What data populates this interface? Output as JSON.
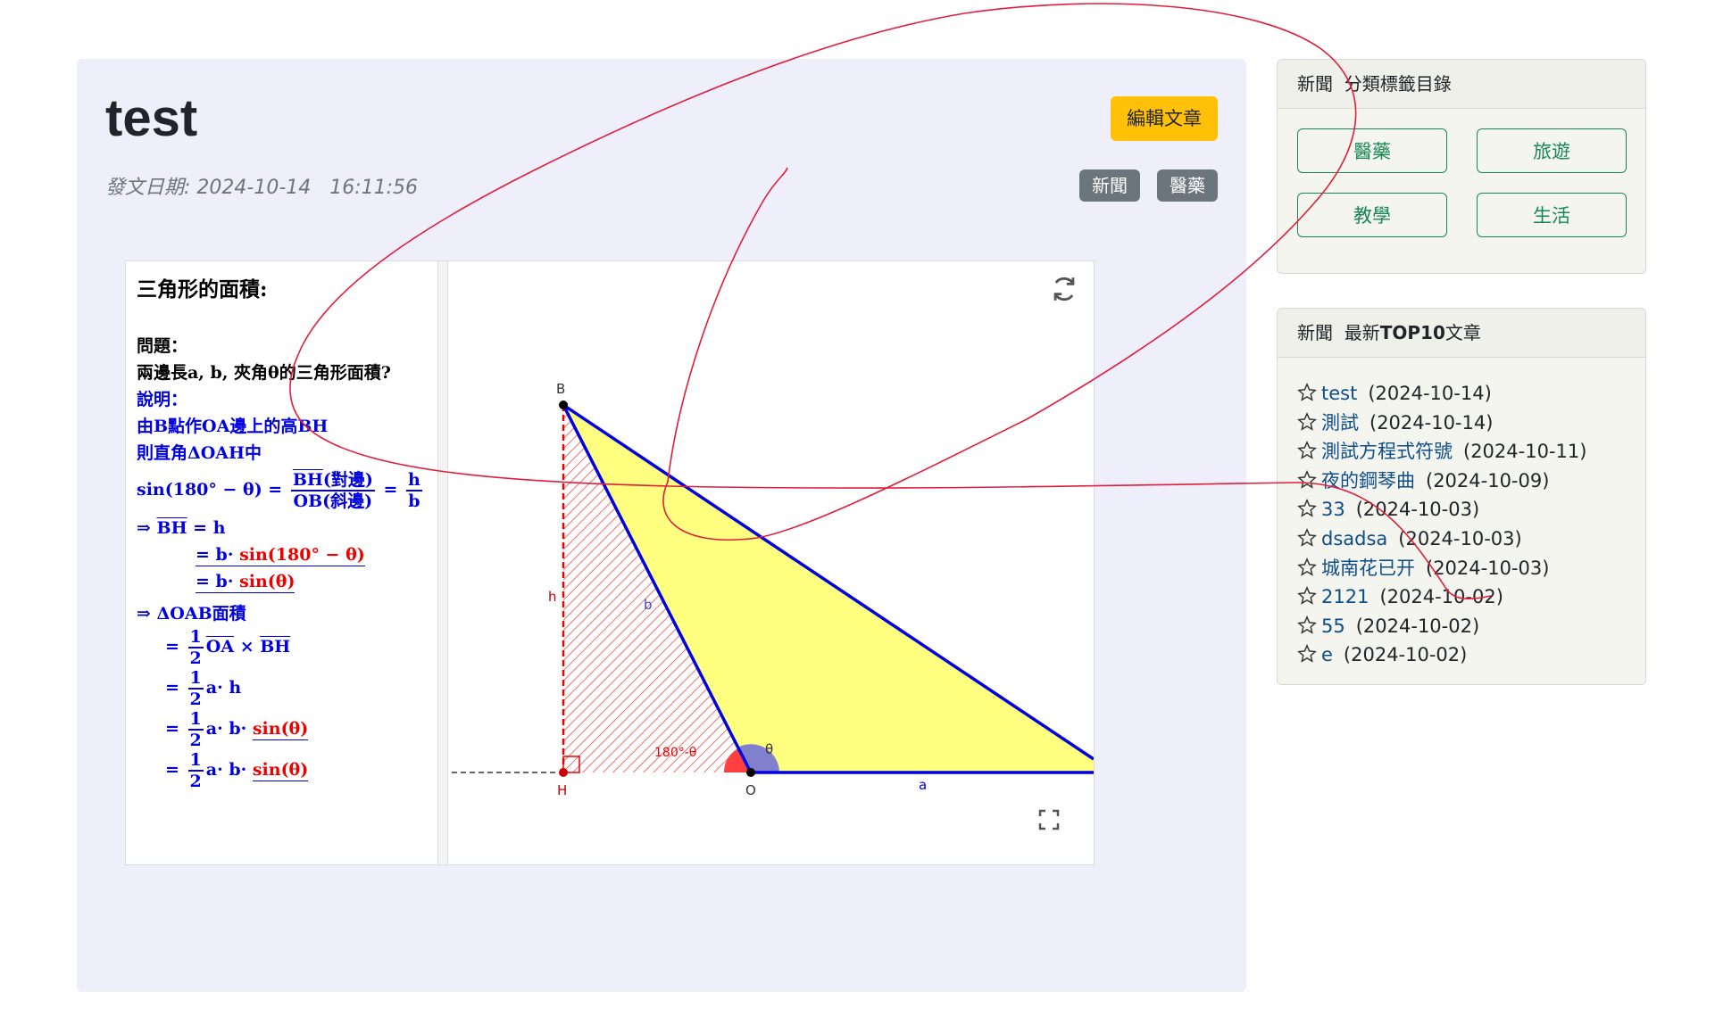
{
  "article": {
    "title": "test",
    "edit_label": "編輯文章",
    "date_label": "發文日期: 2024-10-14   16:11:56",
    "tags": [
      "新聞",
      "醫藥"
    ]
  },
  "applet": {
    "heading": "三角形的面積:",
    "problem_label": "問題：",
    "problem_text": "兩邊長a, b, 夾角θ的三角形面積?",
    "explain_label": "說明：",
    "line1": "由B點作OA邊上的高BH",
    "line2": "則直角ΔOAH中",
    "area_label": "ΔOAB面積",
    "points": {
      "B": "B",
      "H": "H",
      "O": "O"
    },
    "labels": {
      "h": "h",
      "b": "b",
      "a": "a",
      "theta": "θ",
      "supp": "180°-θ"
    }
  },
  "categories": {
    "header": "新聞  分類標籤目錄",
    "items": [
      "醫藥",
      "旅遊",
      "教學",
      "生活"
    ]
  },
  "top10": {
    "header_prefix": "新聞  最新",
    "header_bold": "TOP10",
    "header_suffix": "文章",
    "items": [
      {
        "title": "test",
        "date": "(2024-10-14)"
      },
      {
        "title": "測試",
        "date": "(2024-10-14)"
      },
      {
        "title": "測試方程式符號",
        "date": "(2024-10-11)"
      },
      {
        "title": "夜的鋼琴曲",
        "date": "(2024-10-09)"
      },
      {
        "title": "33",
        "date": "(2024-10-03)"
      },
      {
        "title": "dsadsa",
        "date": "(2024-10-03)"
      },
      {
        "title": "城南花已开",
        "date": "(2024-10-03)"
      },
      {
        "title": "2121",
        "date": "(2024-10-02)"
      },
      {
        "title": "55",
        "date": "(2024-10-02)"
      },
      {
        "title": "e",
        "date": "(2024-10-02)"
      }
    ]
  },
  "colors": {
    "edit_button": "#ffc107",
    "tag_badge": "#6c757d",
    "category_green": "#198754",
    "link_blue": "#0d4d8a",
    "triangle_fill": "#ffff80",
    "triangle_stroke": "#0000e0",
    "annotation_red": "#e01e3c"
  }
}
